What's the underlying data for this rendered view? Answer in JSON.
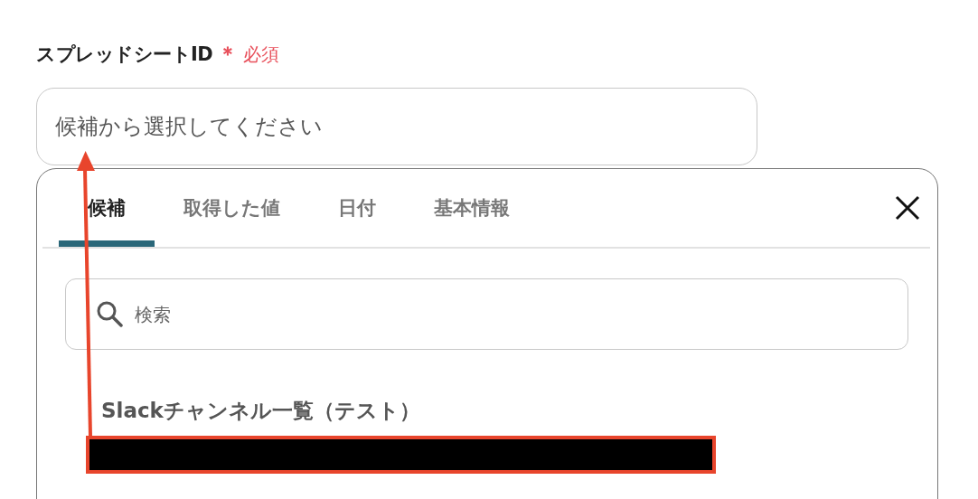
{
  "field": {
    "label": "スプレッドシートID",
    "required_mark": "＊",
    "required_text": "必須",
    "placeholder": "候補から選択してください"
  },
  "dropdown": {
    "tabs": [
      {
        "label": "候補",
        "selected": true
      },
      {
        "label": "取得した値",
        "selected": false
      },
      {
        "label": "日付",
        "selected": false
      },
      {
        "label": "基本情報",
        "selected": false
      }
    ],
    "search": {
      "placeholder": "検索"
    },
    "items": [
      {
        "title": "Slackチャンネル一覧（テスト）"
      }
    ]
  }
}
